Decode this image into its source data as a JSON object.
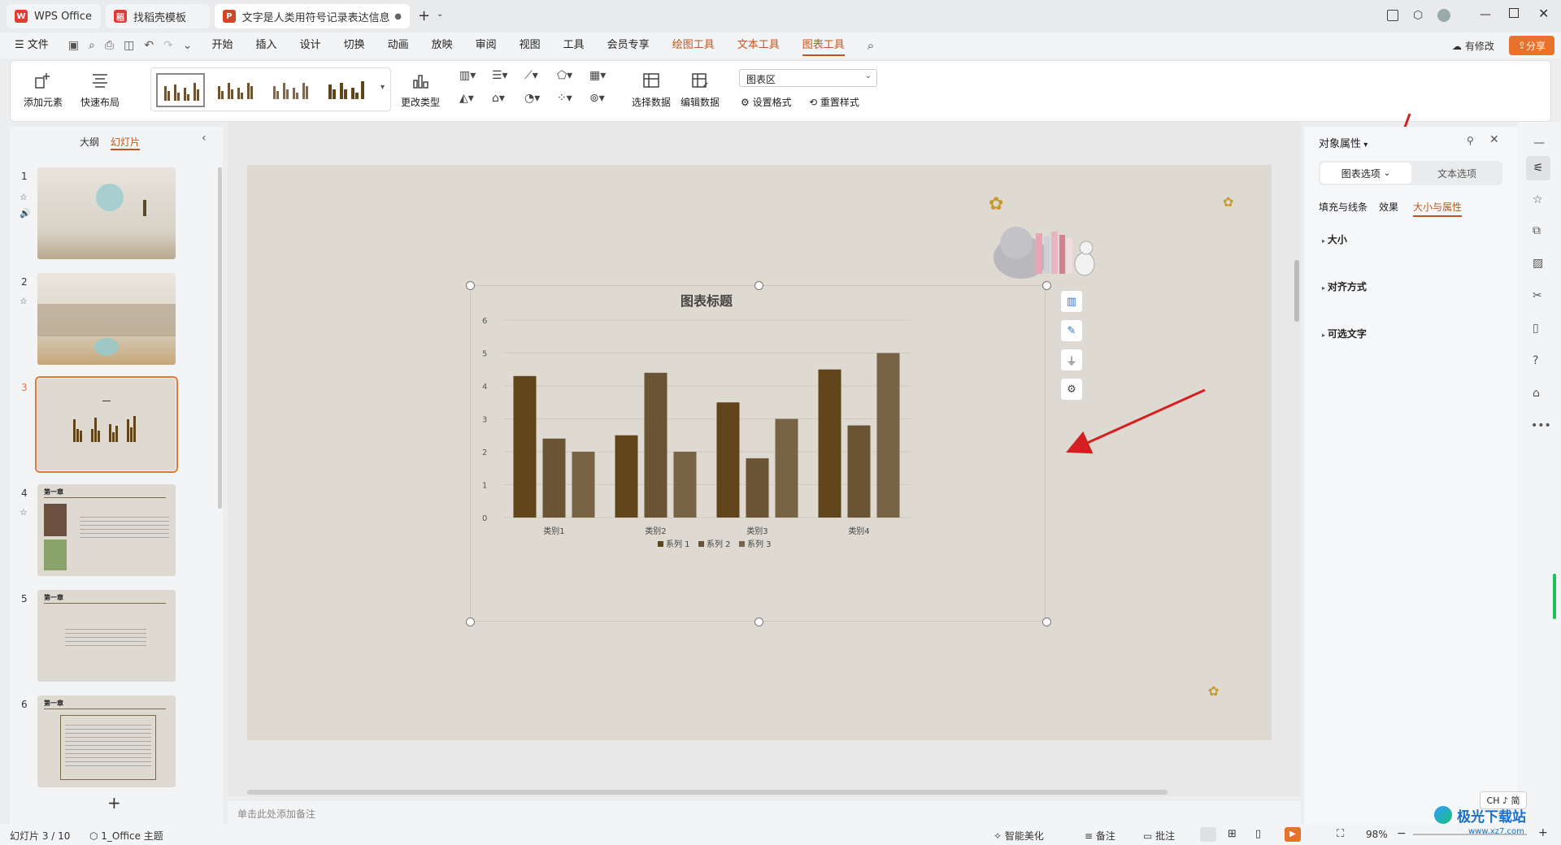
{
  "tabs": [
    {
      "label": "WPS Office"
    },
    {
      "label": "找稻壳模板"
    },
    {
      "label": "文字是人类用符号记录表达信息以"
    }
  ],
  "menu": {
    "file": "文件",
    "items": [
      "开始",
      "插入",
      "设计",
      "切换",
      "动画",
      "放映",
      "审阅",
      "视图",
      "工具",
      "会员专享",
      "绘图工具",
      "文本工具",
      "图表工具"
    ],
    "has_changes": "有修改",
    "share": "分享"
  },
  "ribbon": {
    "add_element": "添加元素",
    "quick_layout": "快速布局",
    "change_type": "更改类型",
    "select_data": "选择数据",
    "edit_data": "编辑数据",
    "chart_area_select": "图表区",
    "set_format": "设置格式",
    "reset_style": "重置样式"
  },
  "left_panel": {
    "outline_tab": "大纲",
    "slides_tab": "幻灯片",
    "slides": [
      {
        "num": "1"
      },
      {
        "num": "2"
      },
      {
        "num": "3"
      },
      {
        "num": "4",
        "heading": "第一章"
      },
      {
        "num": "5",
        "heading": "第一章"
      },
      {
        "num": "6",
        "heading": "第一章"
      }
    ]
  },
  "chart_data": {
    "type": "bar",
    "title": "图表标题",
    "categories": [
      "类别1",
      "类别2",
      "类别3",
      "类别4"
    ],
    "series": [
      {
        "name": "系列 1",
        "values": [
          4.3,
          2.5,
          3.5,
          4.5
        ],
        "color": "#5f4519"
      },
      {
        "name": "系列 2",
        "values": [
          2.4,
          4.4,
          1.8,
          2.8
        ],
        "color": "#6b5433"
      },
      {
        "name": "系列 3",
        "values": [
          2.0,
          2.0,
          3.0,
          5.0
        ],
        "color": "#786345"
      }
    ],
    "yticks": [
      "0",
      "1",
      "2",
      "3",
      "4",
      "5",
      "6"
    ],
    "ylim": [
      0,
      6
    ],
    "grid": true,
    "legend": "bottom"
  },
  "right_panel": {
    "title": "对象属性",
    "tab_chart": "图表选项",
    "tab_text": "文本选项",
    "subtabs": [
      "填充与线条",
      "效果",
      "大小与属性"
    ],
    "sections": [
      "大小",
      "对齐方式",
      "可选文字"
    ]
  },
  "notes_placeholder": "单击此处添加备注",
  "status": {
    "slide_counter": "幻灯片 3 / 10",
    "theme": "1_Office 主题",
    "beautify": "智能美化",
    "notes": "备注",
    "comments": "批注",
    "zoom": "98%",
    "ime": "CH ♪ 简"
  },
  "watermark": "极光下载站",
  "watermark_url": "www.xz7.com",
  "colors": {
    "accent": "#c1551d",
    "share_bg": "#e8712b",
    "annotation": "#d42020"
  }
}
